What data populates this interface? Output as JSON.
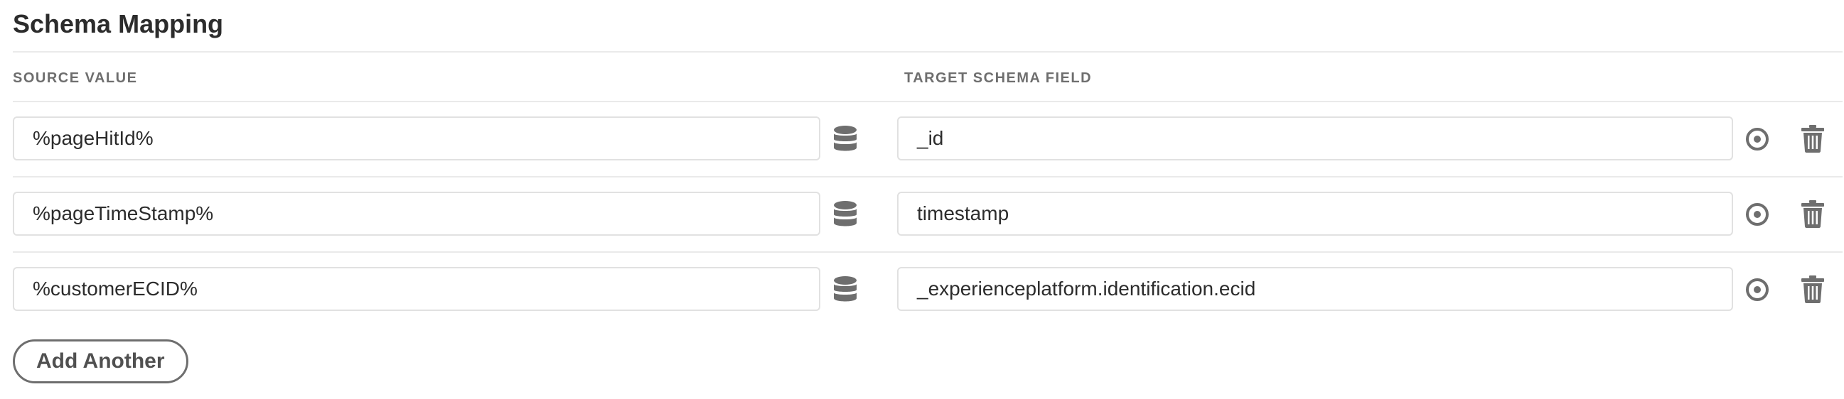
{
  "section": {
    "title": "Schema Mapping"
  },
  "columns": {
    "source_header": "SOURCE VALUE",
    "target_header": "TARGET SCHEMA FIELD"
  },
  "rows": [
    {
      "source": "%pageHitId%",
      "target": "_id"
    },
    {
      "source": "%pageTimeStamp%",
      "target": "timestamp"
    },
    {
      "source": "%customerECID%",
      "target": "_experienceplatform.identification.ecid"
    }
  ],
  "actions": {
    "add_another_label": "Add Another"
  },
  "icons": {
    "data_element": "database-icon",
    "select_field": "target-icon",
    "delete": "trash-icon"
  },
  "colors": {
    "icon": "#6e6e6e",
    "border": "#e1e1e1",
    "text": "#2c2c2c"
  }
}
